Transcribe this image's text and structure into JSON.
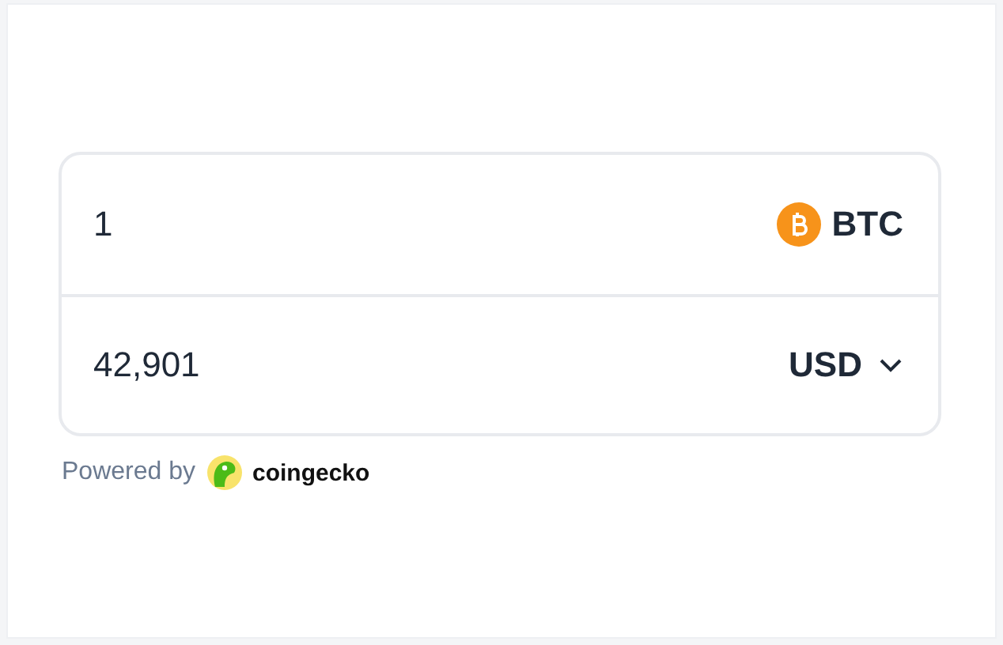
{
  "converter": {
    "rows": [
      {
        "kind": "crypto",
        "amount": "1",
        "currency": "BTC"
      },
      {
        "kind": "fiat",
        "amount": "42,901",
        "currency": "USD"
      }
    ]
  },
  "footer": {
    "label": "Powered by",
    "brand": "coingecko"
  }
}
